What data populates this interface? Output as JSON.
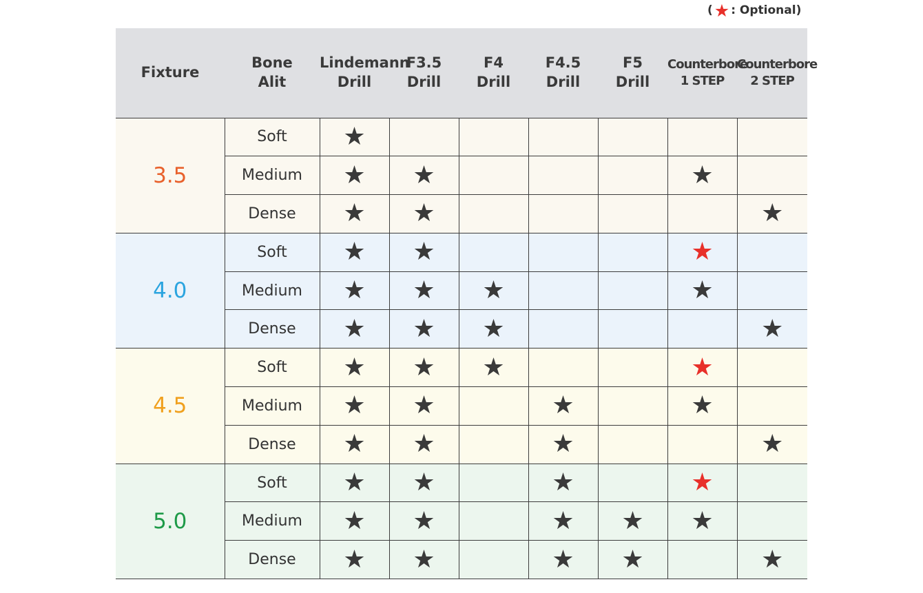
{
  "legend": {
    "open": "(",
    "label": ": Optional)",
    "star_icon": "star-red"
  },
  "columns": [
    {
      "lines": [
        "Fixture"
      ]
    },
    {
      "lines": [
        "Bone",
        "Alit"
      ]
    },
    {
      "lines": [
        "Lindemann",
        "Drill"
      ]
    },
    {
      "lines": [
        "F3.5",
        "Drill"
      ]
    },
    {
      "lines": [
        "F4",
        "Drill"
      ]
    },
    {
      "lines": [
        "F4.5",
        "Drill"
      ]
    },
    {
      "lines": [
        "F5",
        "Drill"
      ]
    },
    {
      "lines": [
        "Counterbore",
        "1 STEP"
      ]
    },
    {
      "lines": [
        "Counterbore",
        "2 STEP"
      ]
    }
  ],
  "groups": [
    {
      "fixture": "3.5",
      "color": "#e8612c",
      "bg": "#fbf8f0",
      "rows": [
        {
          "bone": "Soft",
          "marks": [
            1,
            0,
            0,
            0,
            0,
            0,
            0
          ]
        },
        {
          "bone": "Medium",
          "marks": [
            1,
            1,
            0,
            0,
            0,
            1,
            0
          ]
        },
        {
          "bone": "Dense",
          "marks": [
            1,
            1,
            0,
            0,
            0,
            0,
            1
          ]
        }
      ]
    },
    {
      "fixture": "4.0",
      "color": "#2ba4df",
      "bg": "#ebf3fb",
      "rows": [
        {
          "bone": "Soft",
          "marks": [
            1,
            1,
            0,
            0,
            0,
            2,
            0
          ]
        },
        {
          "bone": "Medium",
          "marks": [
            1,
            1,
            1,
            0,
            0,
            1,
            0
          ]
        },
        {
          "bone": "Dense",
          "marks": [
            1,
            1,
            1,
            0,
            0,
            0,
            1
          ]
        }
      ]
    },
    {
      "fixture": "4.5",
      "color": "#f0a01e",
      "bg": "#fdfbec",
      "rows": [
        {
          "bone": "Soft",
          "marks": [
            1,
            1,
            1,
            0,
            0,
            2,
            0
          ]
        },
        {
          "bone": "Medium",
          "marks": [
            1,
            1,
            0,
            1,
            0,
            1,
            0
          ]
        },
        {
          "bone": "Dense",
          "marks": [
            1,
            1,
            0,
            1,
            0,
            0,
            1
          ]
        }
      ]
    },
    {
      "fixture": "5.0",
      "color": "#1e9a48",
      "bg": "#ecf6ee",
      "rows": [
        {
          "bone": "Soft",
          "marks": [
            1,
            1,
            0,
            1,
            0,
            2,
            0
          ]
        },
        {
          "bone": "Medium",
          "marks": [
            1,
            1,
            0,
            1,
            1,
            1,
            0
          ]
        },
        {
          "bone": "Dense",
          "marks": [
            1,
            1,
            0,
            1,
            1,
            0,
            1
          ]
        }
      ]
    }
  ],
  "mark_legend": {
    "0": "none",
    "1": "star-dark (required)",
    "2": "star-red (optional)"
  }
}
